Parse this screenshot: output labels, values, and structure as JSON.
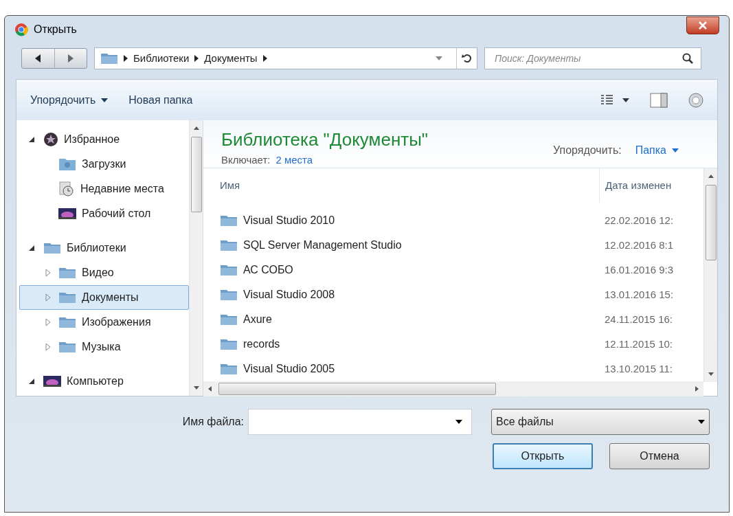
{
  "window": {
    "title": "Открыть"
  },
  "address": {
    "path": [
      "Библиотеки",
      "Документы"
    ]
  },
  "search": {
    "placeholder": "Поиск: Документы"
  },
  "toolbar": {
    "organize": "Упорядочить",
    "new_folder": "Новая папка"
  },
  "sidebar": {
    "items": [
      {
        "label": "Избранное",
        "kind": "favorites",
        "expanded": true,
        "selected": false,
        "children": [
          {
            "label": "Загрузки",
            "kind": "downloads",
            "selected": false
          },
          {
            "label": "Недавние места",
            "kind": "recent",
            "selected": false
          },
          {
            "label": "Рабочий стол",
            "kind": "desktop",
            "selected": false
          }
        ]
      },
      {
        "label": "Библиотеки",
        "kind": "folder",
        "expanded": true,
        "selected": false,
        "children": [
          {
            "label": "Видео",
            "kind": "folder",
            "expanded": false,
            "selected": false
          },
          {
            "label": "Документы",
            "kind": "folder",
            "expanded": false,
            "selected": true
          },
          {
            "label": "Изображения",
            "kind": "folder",
            "expanded": false,
            "selected": false
          },
          {
            "label": "Музыка",
            "kind": "folder",
            "expanded": false,
            "selected": false
          }
        ]
      },
      {
        "label": "Компьютер",
        "kind": "desktop",
        "expanded": true,
        "selected": false
      }
    ]
  },
  "library": {
    "title": "Библиотека \"Документы\"",
    "includes_label": "Включает:",
    "includes_link": "2 места",
    "arrange_label": "Упорядочить:",
    "arrange_value": "Папка"
  },
  "table": {
    "columns": [
      "Имя",
      "Дата изменен"
    ],
    "rows": [
      {
        "name": "Visual Studio 2010",
        "date": "22.02.2016 12:"
      },
      {
        "name": "SQL Server Management Studio",
        "date": "12.02.2016 8:1"
      },
      {
        "name": "АС СОБО",
        "date": "16.01.2016 9:3"
      },
      {
        "name": "Visual Studio 2008",
        "date": "13.01.2016 15:"
      },
      {
        "name": "Axure",
        "date": "24.11.2015 16:"
      },
      {
        "name": "records",
        "date": "12.11.2015 10:"
      },
      {
        "name": "Visual Studio 2005",
        "date": "13.10.2015 11:"
      }
    ]
  },
  "file_name": {
    "label": "Имя файла:"
  },
  "file_type": {
    "value": "Все файлы"
  },
  "buttons": [
    {
      "label": "Открыть",
      "default": true
    },
    {
      "label": "Отмена",
      "default": false
    }
  ]
}
